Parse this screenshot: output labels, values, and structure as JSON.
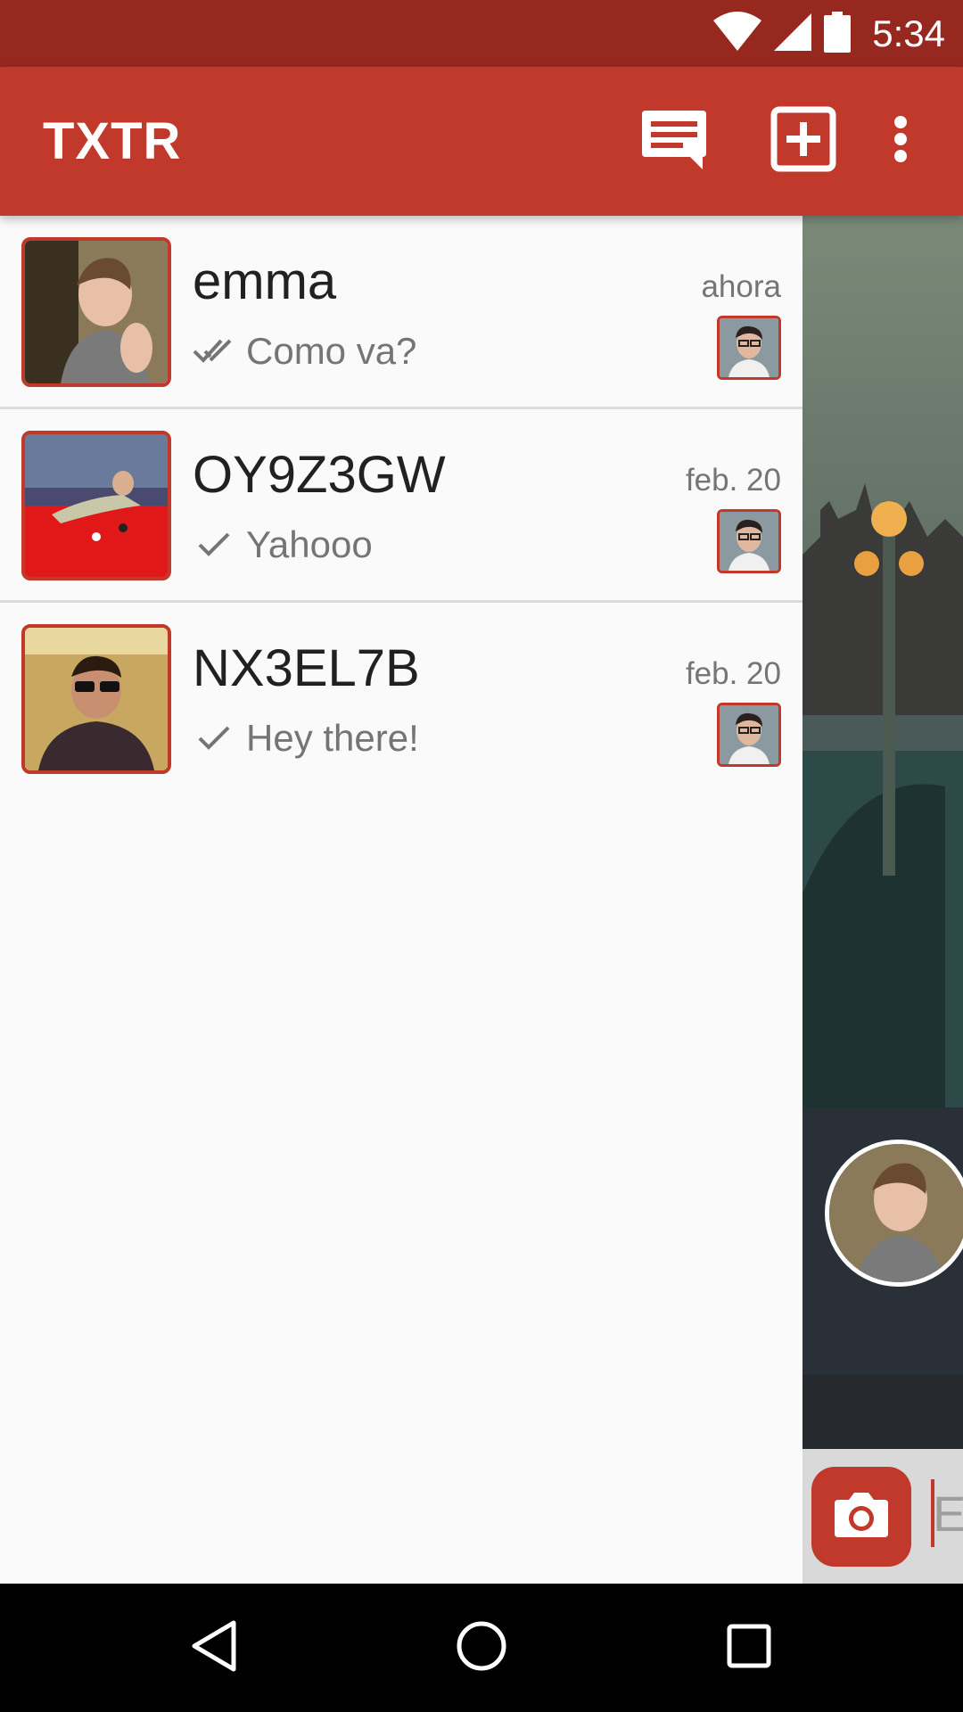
{
  "status_bar": {
    "time": "5:34",
    "icons": [
      "wifi-icon",
      "cell-signal-icon",
      "battery-icon"
    ]
  },
  "app_bar": {
    "title": "TXTR",
    "actions": [
      "chat-icon",
      "add-box-icon",
      "more-vert-icon"
    ]
  },
  "conversations": [
    {
      "name": "emma",
      "time": "ahora",
      "message": "Como va?",
      "status": "double-check-icon"
    },
    {
      "name": "OY9Z3GW",
      "time": "feb. 20",
      "message": "Yahooo",
      "status": "check-icon"
    },
    {
      "name": "NX3EL7B",
      "time": "feb. 20",
      "message": "Hey there!",
      "status": "check-icon"
    }
  ],
  "side_panel": {
    "compose_hint": "E"
  },
  "colors": {
    "status_bar": "#972820",
    "app_bar": "#c0392b",
    "accent": "#c0392b"
  },
  "nav_bar": {
    "buttons": [
      "back-icon",
      "home-icon",
      "recent-apps-icon"
    ]
  }
}
